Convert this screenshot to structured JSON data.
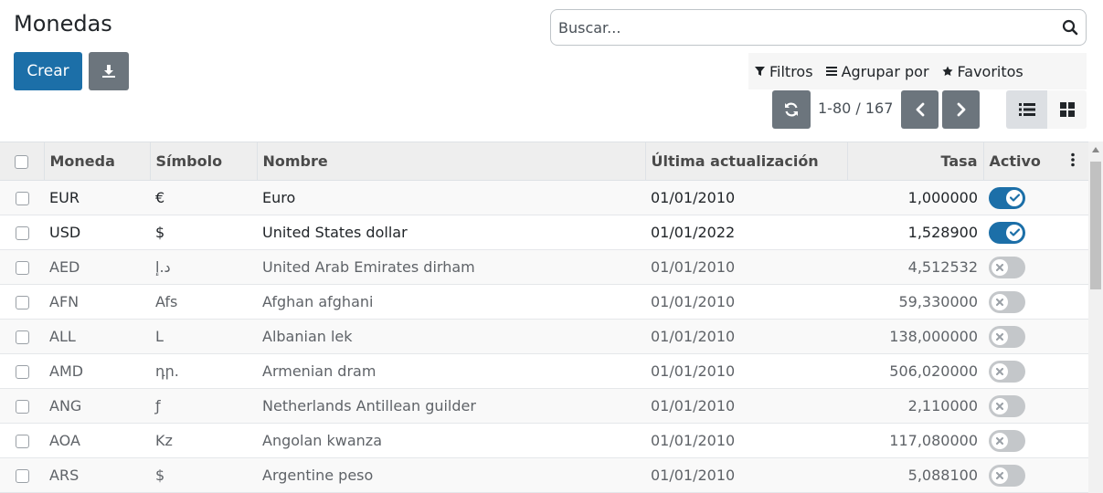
{
  "page": {
    "title": "Monedas"
  },
  "toolbar": {
    "create_label": "Crear",
    "download_icon": "download-icon"
  },
  "search": {
    "placeholder": "Buscar..."
  },
  "filters": {
    "filters_label": "Filtros",
    "group_label": "Agrupar por",
    "favorites_label": "Favoritos"
  },
  "pager": {
    "range": "1-80 / 167"
  },
  "table": {
    "columns": {
      "moneda": "Moneda",
      "simbolo": "Símbolo",
      "nombre": "Nombre",
      "ultima": "Última actualización",
      "tasa": "Tasa",
      "activo": "Activo"
    },
    "rows": [
      {
        "code": "EUR",
        "symbol": "€",
        "name": "Euro",
        "date": "01/01/2010",
        "rate": "1,000000",
        "active": true
      },
      {
        "code": "USD",
        "symbol": "$",
        "name": "United States dollar",
        "date": "01/01/2022",
        "rate": "1,528900",
        "active": true
      },
      {
        "code": "AED",
        "symbol": "د.إ",
        "name": "United Arab Emirates dirham",
        "date": "01/01/2010",
        "rate": "4,512532",
        "active": false
      },
      {
        "code": "AFN",
        "symbol": "Afs",
        "name": "Afghan afghani",
        "date": "01/01/2010",
        "rate": "59,330000",
        "active": false
      },
      {
        "code": "ALL",
        "symbol": "L",
        "name": "Albanian lek",
        "date": "01/01/2010",
        "rate": "138,000000",
        "active": false
      },
      {
        "code": "AMD",
        "symbol": "դր.",
        "name": "Armenian dram",
        "date": "01/01/2010",
        "rate": "506,020000",
        "active": false
      },
      {
        "code": "ANG",
        "symbol": "ƒ",
        "name": "Netherlands Antillean guilder",
        "date": "01/01/2010",
        "rate": "2,110000",
        "active": false
      },
      {
        "code": "AOA",
        "symbol": "Kz",
        "name": "Angolan kwanza",
        "date": "01/01/2010",
        "rate": "117,080000",
        "active": false
      },
      {
        "code": "ARS",
        "symbol": "$",
        "name": "Argentine peso",
        "date": "01/01/2010",
        "rate": "5,088100",
        "active": false
      }
    ]
  },
  "colors": {
    "primary": "#1c6fa8",
    "secondary": "#6c757d",
    "toggle_off": "#c4c7ca"
  }
}
